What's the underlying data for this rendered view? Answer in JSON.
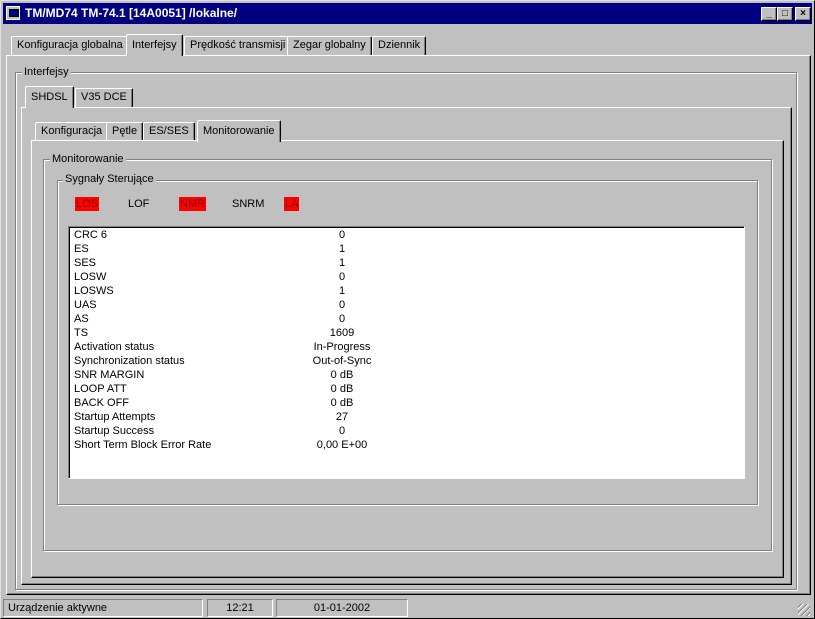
{
  "window": {
    "title": "TM/MD74 TM-74.1 [14A0051] /lokalne/",
    "icons": {
      "app": "monitor-icon",
      "minimize": "minimize-icon",
      "maximize": "maximize-icon",
      "close": "close-icon"
    },
    "min_glyph": "_",
    "max_glyph": "□",
    "close_glyph": "×"
  },
  "main_tabs": [
    {
      "label": "Konfiguracja globalna"
    },
    {
      "label": "Interfejsy"
    },
    {
      "label": "Prędkość transmisji"
    },
    {
      "label": "Zegar globalny"
    },
    {
      "label": "Dziennik"
    }
  ],
  "interfaces_group": {
    "label": "Interfejsy"
  },
  "interface_tabs": [
    {
      "label": "SHDSL"
    },
    {
      "label": "V35 DCE"
    }
  ],
  "sub_tabs": [
    {
      "label": "Konfiguracja"
    },
    {
      "label": "Pętle"
    },
    {
      "label": "ES/SES"
    },
    {
      "label": "Monitorowanie"
    }
  ],
  "monitoring_group": {
    "label": "Monitorowanie"
  },
  "signals_group": {
    "label": "Sygnały Sterujące"
  },
  "signals": [
    {
      "label": "LOS",
      "active": true
    },
    {
      "label": "LOF",
      "active": false
    },
    {
      "label": "NMR",
      "active": true
    },
    {
      "label": "SNRM",
      "active": false
    },
    {
      "label": "LA",
      "active": true
    }
  ],
  "stats": [
    {
      "label": "CRC 6",
      "value": "0"
    },
    {
      "label": "ES",
      "value": "1"
    },
    {
      "label": "SES",
      "value": "1"
    },
    {
      "label": "LOSW",
      "value": "0"
    },
    {
      "label": "LOSWS",
      "value": "1"
    },
    {
      "label": "UAS",
      "value": "0"
    },
    {
      "label": "AS",
      "value": "0"
    },
    {
      "label": "TS",
      "value": "1609"
    },
    {
      "label": "Activation status",
      "value": "In-Progress"
    },
    {
      "label": "Synchronization status",
      "value": "Out-of-Sync"
    },
    {
      "label": "SNR MARGIN",
      "value": "0 dB"
    },
    {
      "label": "LOOP ATT",
      "value": "0 dB"
    },
    {
      "label": "BACK OFF",
      "value": "0 dB"
    },
    {
      "label": "Startup Attempts",
      "value": "27"
    },
    {
      "label": "Startup Success",
      "value": "0"
    },
    {
      "label": "Short Term Block Error Rate",
      "value": "0,00 E+00"
    }
  ],
  "statusbar": {
    "status": "Urządzenie aktywne",
    "time": "12:21",
    "date": "01-01-2002"
  },
  "colors": {
    "titlebar": "#000080",
    "face": "#c0c0c0",
    "alarm_bg": "#ff0000",
    "alarm_text": "#800000"
  }
}
